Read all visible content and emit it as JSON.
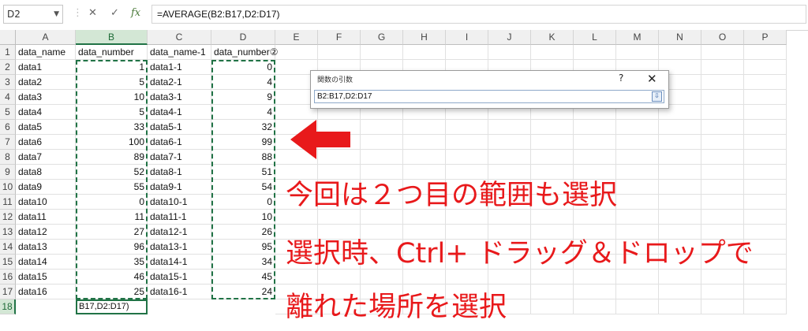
{
  "namebox": {
    "value": "D2"
  },
  "formula_bar": {
    "cancel": "✕",
    "enter": "✓",
    "fx": "fx",
    "formula": "=AVERAGE(B2:B17,D2:D17)"
  },
  "columns": [
    "A",
    "B",
    "C",
    "D",
    "E",
    "F",
    "G",
    "H",
    "I",
    "J",
    "K",
    "L",
    "M",
    "N",
    "O",
    "P"
  ],
  "rows": [
    "1",
    "2",
    "3",
    "4",
    "5",
    "6",
    "7",
    "8",
    "9",
    "10",
    "11",
    "12",
    "13",
    "14",
    "15",
    "16",
    "17",
    "18"
  ],
  "headers": {
    "a": "data_name",
    "b": "data_number",
    "c": "data_name-1",
    "d": "data_number②"
  },
  "data": [
    {
      "a": "data1",
      "b": "1",
      "c": "data1-1",
      "d": "0"
    },
    {
      "a": "data2",
      "b": "5",
      "c": "data2-1",
      "d": "4"
    },
    {
      "a": "data3",
      "b": "10",
      "c": "data3-1",
      "d": "9"
    },
    {
      "a": "data4",
      "b": "5",
      "c": "data4-1",
      "d": "4"
    },
    {
      "a": "data5",
      "b": "33",
      "c": "data5-1",
      "d": "32"
    },
    {
      "a": "data6",
      "b": "100",
      "c": "data6-1",
      "d": "99"
    },
    {
      "a": "data7",
      "b": "89",
      "c": "data7-1",
      "d": "88"
    },
    {
      "a": "data8",
      "b": "52",
      "c": "data8-1",
      "d": "51"
    },
    {
      "a": "data9",
      "b": "55",
      "c": "data9-1",
      "d": "54"
    },
    {
      "a": "data10",
      "b": "0",
      "c": "data10-1",
      "d": "0"
    },
    {
      "a": "data11",
      "b": "11",
      "c": "data11-1",
      "d": "10"
    },
    {
      "a": "data12",
      "b": "27",
      "c": "data12-1",
      "d": "26"
    },
    {
      "a": "data13",
      "b": "96",
      "c": "data13-1",
      "d": "95"
    },
    {
      "a": "data14",
      "b": "35",
      "c": "data14-1",
      "d": "34"
    },
    {
      "a": "data15",
      "b": "46",
      "c": "data15-1",
      "d": "45"
    },
    {
      "a": "data16",
      "b": "25",
      "c": "data16-1",
      "d": "24"
    }
  ],
  "active_cell_text": "B17,D2:D17)",
  "dialog": {
    "title": "関数の引数",
    "help": "?",
    "close": "✕",
    "input": "B2:B17,D2:D17"
  },
  "annotations": [
    "今回は２つ目の範囲も選択",
    "選択時、Ctrl+ ドラッグ＆ドロップで",
    "離れた場所を選択"
  ],
  "colors": {
    "accent": "#217346",
    "annotation": "#e8191b"
  }
}
